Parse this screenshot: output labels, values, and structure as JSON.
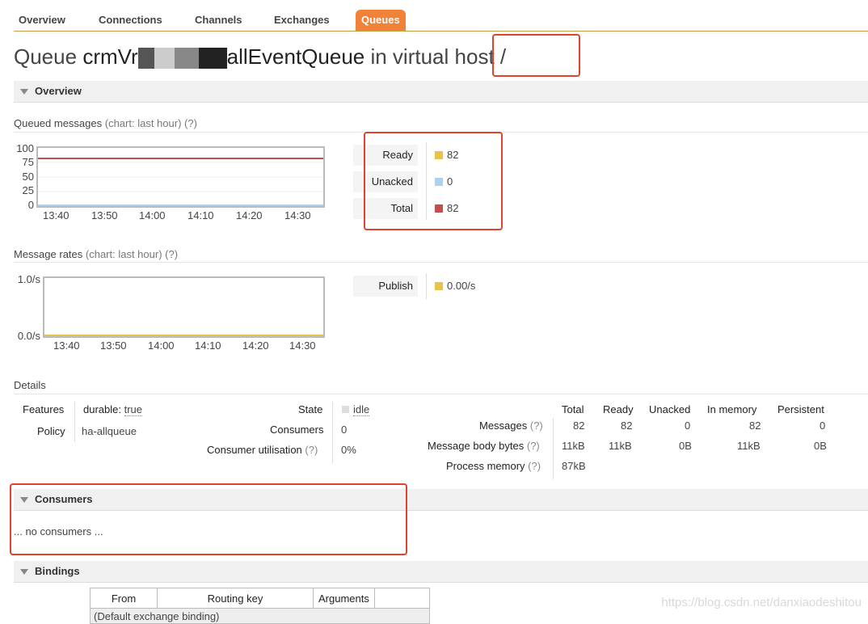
{
  "nav": {
    "tabs": [
      {
        "label": "Overview"
      },
      {
        "label": "Connections"
      },
      {
        "label": "Channels"
      },
      {
        "label": "Exchanges"
      },
      {
        "label": "Queues"
      }
    ]
  },
  "title": {
    "prefix": "Queue",
    "name_start": "crmVr",
    "name_end": "allEventQueue",
    "mid": "in virtual",
    "host_word": "host",
    "vhost": "/"
  },
  "sections": {
    "overview": "Overview",
    "consumers": "Consumers",
    "bindings": "Bindings"
  },
  "queued": {
    "heading": "Queued messages",
    "chart_note": "(chart: last hour)",
    "help": "(?)",
    "y_ticks": [
      "100",
      "75",
      "50",
      "25",
      "0"
    ],
    "x_ticks": [
      "13:40",
      "13:50",
      "14:00",
      "14:10",
      "14:20",
      "14:30"
    ],
    "stats": [
      {
        "label": "Ready",
        "value": "82",
        "color": "#e8c24b"
      },
      {
        "label": "Unacked",
        "value": "0",
        "color": "#aed2ee"
      },
      {
        "label": "Total",
        "value": "82",
        "color": "#c0504d"
      }
    ]
  },
  "rates": {
    "heading": "Message rates",
    "chart_note": "(chart: last hour)",
    "help": "(?)",
    "y_ticks": [
      "1.0/s",
      "0.0/s"
    ],
    "x_ticks": [
      "13:40",
      "13:50",
      "14:00",
      "14:10",
      "14:20",
      "14:30"
    ],
    "stats": [
      {
        "label": "Publish",
        "value": "0.00/s",
        "color": "#e8c24b"
      }
    ]
  },
  "chart_data": [
    {
      "type": "line",
      "x": [
        "13:40",
        "13:50",
        "14:00",
        "14:10",
        "14:20",
        "14:30"
      ],
      "ylim": [
        0,
        100
      ],
      "series": [
        {
          "name": "Ready",
          "values": [
            82,
            82,
            82,
            82,
            82,
            82
          ]
        },
        {
          "name": "Unacked",
          "values": [
            0,
            0,
            0,
            0,
            0,
            0
          ]
        },
        {
          "name": "Total",
          "values": [
            82,
            82,
            82,
            82,
            82,
            82
          ]
        }
      ]
    },
    {
      "type": "line",
      "x": [
        "13:40",
        "13:50",
        "14:00",
        "14:10",
        "14:20",
        "14:30"
      ],
      "ylim": [
        0,
        1
      ],
      "series": [
        {
          "name": "Publish",
          "values": [
            0,
            0,
            0,
            0,
            0,
            0
          ]
        }
      ]
    }
  ],
  "details": {
    "heading": "Details",
    "features_label": "Features",
    "features_key": "durable:",
    "features_val": "true",
    "policy_label": "Policy",
    "policy_val": "ha-allqueue",
    "state_label": "State",
    "state_val": "idle",
    "consumers_label": "Consumers",
    "consumers_val": "0",
    "util_label": "Consumer utilisation",
    "util_help": "(?)",
    "util_val": "0%",
    "stats_headers": [
      "Total",
      "Ready",
      "Unacked",
      "In memory",
      "Persistent"
    ],
    "rows": [
      {
        "label": "Messages",
        "help": "(?)",
        "values": [
          "82",
          "82",
          "0",
          "82",
          "0"
        ]
      },
      {
        "label": "Message body bytes",
        "help": "(?)",
        "values": [
          "11kB",
          "11kB",
          "0B",
          "11kB",
          "0B"
        ]
      },
      {
        "label": "Process memory",
        "help": "(?)",
        "values": [
          "87kB",
          "",
          "",
          "",
          ""
        ]
      }
    ]
  },
  "consumers": {
    "empty_text": "... no consumers ..."
  },
  "bindings": {
    "headers": [
      "From",
      "Routing key",
      "Arguments",
      ""
    ],
    "first_row": "(Default exchange binding)"
  },
  "watermark": "https://blog.csdn.net/danxiaodeshitou"
}
